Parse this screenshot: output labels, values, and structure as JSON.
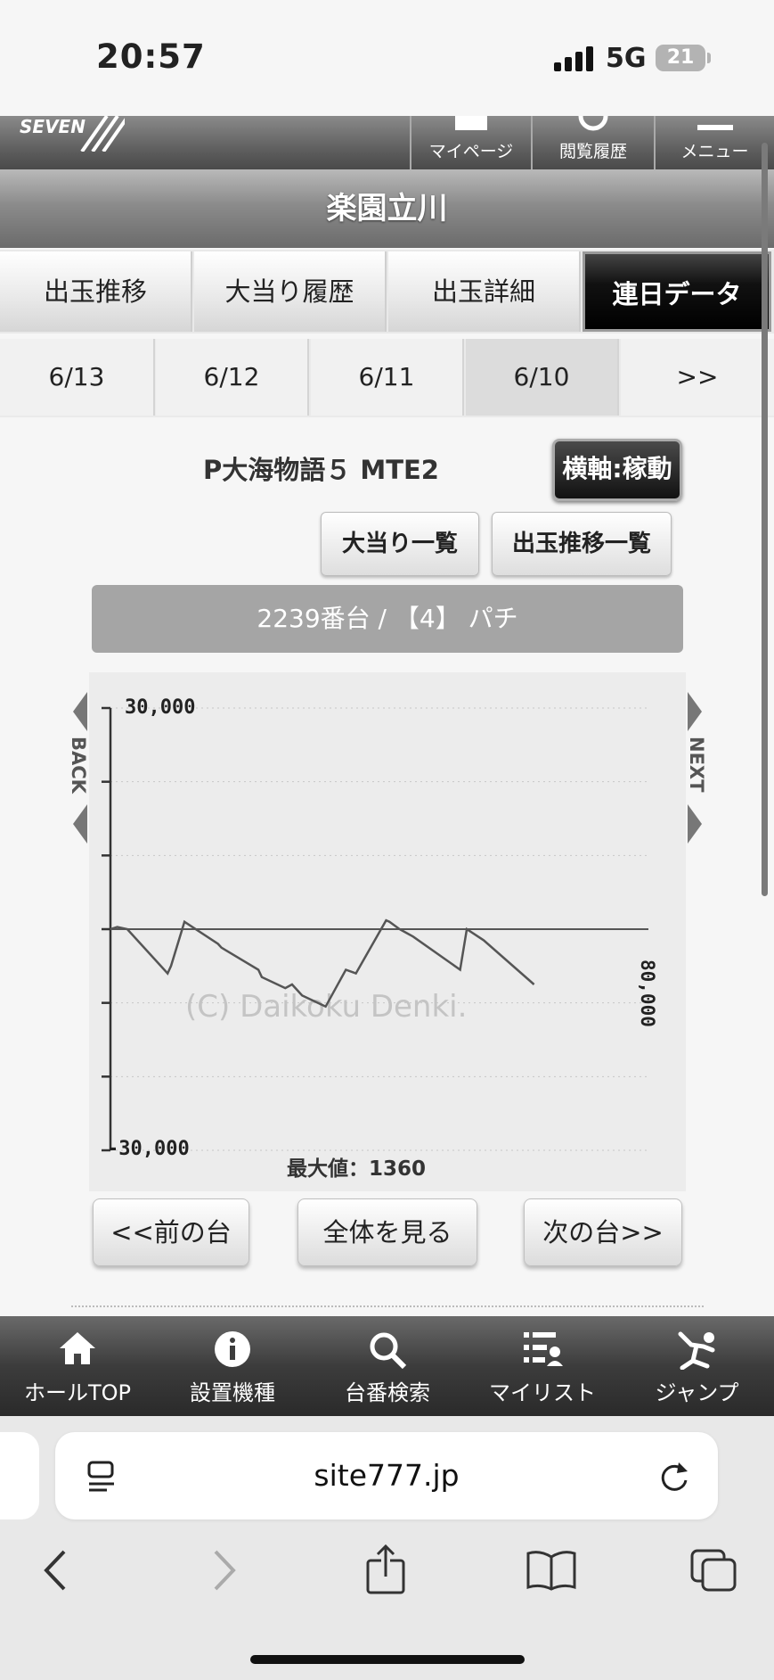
{
  "status_bar": {
    "time": "20:57",
    "network": "5G",
    "battery": "21"
  },
  "header": {
    "logo_text": "SEVEN",
    "mypage_label": "マイページ",
    "history_label": "閲覧履歴",
    "menu_label": "メニュー"
  },
  "hall_title": "楽園立川",
  "tabs": [
    {
      "label": "出玉推移"
    },
    {
      "label": "大当り履歴"
    },
    {
      "label": "出玉詳細"
    },
    {
      "label": "連日データ"
    }
  ],
  "date_tabs": [
    {
      "label": "6/13"
    },
    {
      "label": "6/12"
    },
    {
      "label": "6/11"
    },
    {
      "label": "6/10"
    },
    {
      "label": ">>"
    }
  ],
  "model_name": "P大海物語５ MTE2",
  "axis_toggle_label": "横軸:稼動",
  "jackpot_list_label": "大当り一覧",
  "payout_list_label": "出玉推移一覧",
  "machine_banner": "2239番台 / 【4】 パチ",
  "chart": {
    "back_label": "BACK",
    "next_label": "NEXT",
    "watermark": "(C) Daikoku Denki.",
    "x_max_label": "80,000",
    "max_value_label": "最大値：1360"
  },
  "chart_data": {
    "type": "line",
    "y_ticks": [
      "30,000",
      "-30,000"
    ],
    "ylim": [
      -30000,
      30000
    ],
    "xlim": [
      0,
      80000
    ],
    "x": [
      0,
      1000,
      2500,
      8500,
      9000,
      11000,
      16000,
      16500,
      22000,
      22500,
      26000,
      27000,
      28500,
      32000,
      35000,
      36500,
      41000,
      41500,
      43000,
      44000,
      45000,
      52000,
      53000,
      55500,
      63000
    ],
    "y": [
      0,
      300,
      0,
      -6000,
      -5000,
      1000,
      -2000,
      -2500,
      -5500,
      -6500,
      -8000,
      -7500,
      -9000,
      -10500,
      -5500,
      -6000,
      1200,
      1000,
      0,
      -500,
      -1000,
      -5500,
      0,
      -1500,
      -7500
    ],
    "ylabel": "",
    "xlabel": ""
  },
  "nav_buttons": {
    "prev_label": "<<前の台",
    "all_label": "全体を見る",
    "next_label": "次の台>>"
  },
  "bottom_nav": [
    {
      "label": "ホールTOP",
      "icon": "home-icon"
    },
    {
      "label": "設置機種",
      "icon": "info-icon"
    },
    {
      "label": "台番検索",
      "icon": "search-icon"
    },
    {
      "label": "マイリスト",
      "icon": "list-icon"
    },
    {
      "label": "ジャンプ",
      "icon": "jump-icon"
    }
  ],
  "browser": {
    "url": "site777.jp"
  }
}
